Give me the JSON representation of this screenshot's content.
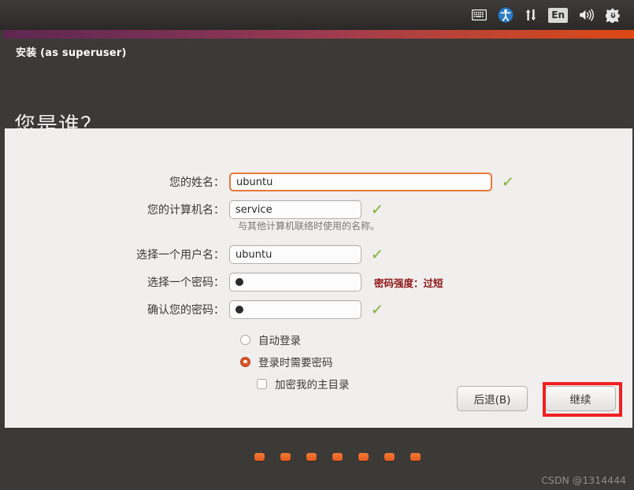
{
  "top_panel": {
    "icons": [
      {
        "name": "keyboard-icon",
        "label": "keyboard-indicator"
      },
      {
        "name": "accessibility-icon",
        "label": "universal-access"
      },
      {
        "name": "network-icon",
        "label": "network-updown"
      },
      {
        "name": "language-icon",
        "label": "En"
      },
      {
        "name": "volume-icon",
        "label": "volume"
      },
      {
        "name": "power-icon",
        "label": "session-power"
      }
    ],
    "language": "En"
  },
  "window": {
    "title": "安装 (as superuser)",
    "heading": "您是谁？"
  },
  "form": {
    "fields": [
      {
        "label": "您的姓名：",
        "value": "ubuntu",
        "status": "✓",
        "focused": true,
        "masked": false,
        "width": "wide"
      },
      {
        "label": "您的计算机名：",
        "value": "service",
        "status": "✓",
        "focused": false,
        "masked": false,
        "width": "short",
        "hint": "与其他计算机联络时使用的名称。"
      },
      {
        "label": "选择一个用户名：",
        "value": "ubuntu",
        "status": "✓",
        "focused": false,
        "masked": false,
        "width": "short"
      },
      {
        "label": "选择一个密码：",
        "value": "●",
        "status": "",
        "strength": "密码强度：过短",
        "focused": false,
        "masked": true,
        "width": "short"
      },
      {
        "label": "确认您的密码：",
        "value": "●",
        "status": "✓",
        "focused": false,
        "masked": true,
        "width": "short"
      }
    ],
    "options": [
      {
        "label": "自动登录",
        "type": "radio",
        "checked": false
      },
      {
        "label": "登录时需要密码",
        "type": "radio",
        "checked": true
      },
      {
        "label": "加密我的主目录",
        "type": "checkbox",
        "checked": false
      }
    ]
  },
  "buttons": {
    "back": "后退(B)",
    "continue": "继续"
  },
  "progress": {
    "dot_count": 7
  },
  "watermark": "CSDN @1314444",
  "colors": {
    "accent_orange": "#dd4814",
    "focus_border": "#e8793a",
    "check_green": "#7fb238",
    "strength_red": "#8e1616",
    "annotation_red": "#f02020",
    "panel_bg": "#f0efed",
    "window_bg": "#3b3a36"
  }
}
